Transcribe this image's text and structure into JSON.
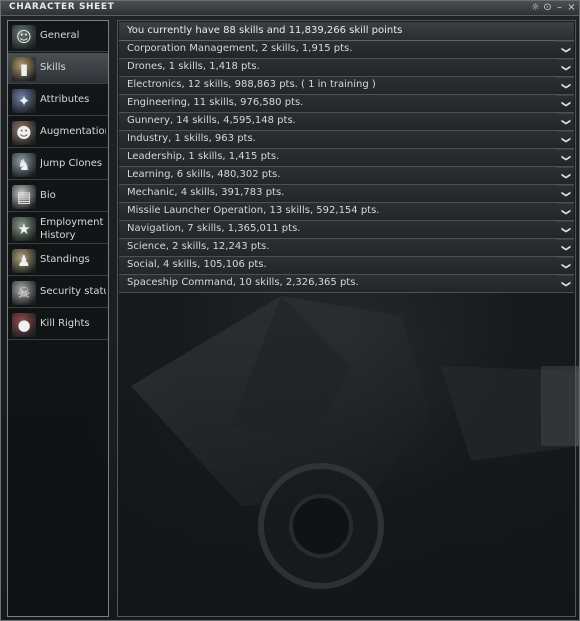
{
  "window": {
    "title": "CHARACTER SHEET"
  },
  "titlebar_buttons": {
    "config": "☼",
    "info": "⊙",
    "minimize": "–",
    "close": "×"
  },
  "sidebar": {
    "items": [
      {
        "label": "General",
        "icon": "portrait-icon",
        "glyph": "☺",
        "active": false
      },
      {
        "label": "Skills",
        "icon": "skillbook-icon",
        "glyph": "▮",
        "active": true
      },
      {
        "label": "Attributes",
        "icon": "attributes-icon",
        "glyph": "✦",
        "active": false
      },
      {
        "label": "Augmentations",
        "icon": "augmentations-icon",
        "glyph": "☻",
        "active": false
      },
      {
        "label": "Jump Clones",
        "icon": "jump-clones-icon",
        "glyph": "♞",
        "active": false
      },
      {
        "label": "Bio",
        "icon": "bio-icon",
        "glyph": "▤",
        "active": false
      },
      {
        "label": "Employment History",
        "icon": "employment-history-icon",
        "glyph": "★",
        "active": false
      },
      {
        "label": "Standings",
        "icon": "standings-icon",
        "glyph": "♟",
        "active": false
      },
      {
        "label": "Security status",
        "icon": "security-status-icon",
        "glyph": "☠",
        "active": false
      },
      {
        "label": "Kill Rights",
        "icon": "kill-rights-icon",
        "glyph": "●",
        "active": false
      }
    ]
  },
  "skills": {
    "summary": "You currently have 88 skills and 11,839,266 skill points",
    "groups": [
      "Corporation Management, 2 skills, 1,915 pts.",
      "Drones, 1 skills, 1,418 pts.",
      "Electronics, 12 skills, 988,863 pts. ( 1 in training )",
      "Engineering, 11 skills, 976,580 pts.",
      "Gunnery, 14 skills, 4,595,148 pts.",
      "Industry, 1 skills, 963 pts.",
      "Leadership, 1 skills, 1,415 pts.",
      "Learning, 6 skills, 480,302 pts.",
      "Mechanic, 4 skills, 391,783 pts.",
      "Missile Launcher Operation, 13 skills, 592,154 pts.",
      "Navigation, 7 skills, 1,365,011 pts.",
      "Science, 2 skills, 12,243 pts.",
      "Social, 4 skills, 105,106 pts.",
      "Spaceship Command, 10 skills, 2,326,365 pts."
    ],
    "expand_glyph": "❯"
  },
  "colors": {
    "accent": "#7a7f82",
    "background": "#16191b"
  }
}
